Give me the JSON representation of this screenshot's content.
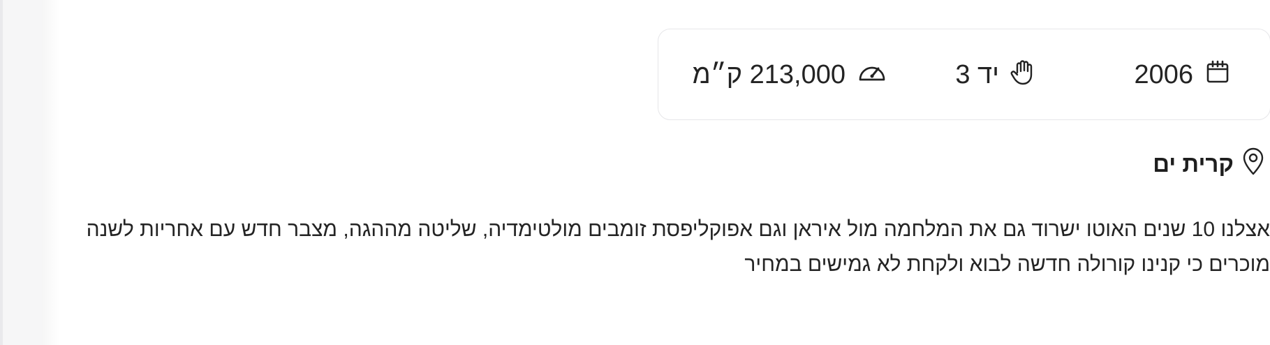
{
  "specs": {
    "year": {
      "icon": "calendar-icon",
      "value": "2006"
    },
    "hand": {
      "icon": "hand-icon",
      "value": "יד 3"
    },
    "mileage": {
      "icon": "speedometer-icon",
      "value": "213,000 ק״מ"
    }
  },
  "location": {
    "icon": "location-pin-icon",
    "label": "קרית ים"
  },
  "description": {
    "text": "אצלנו 10 שנים האוטו ישרוד גם את המלחמה מול איראן וגם אפוקליפסת זומבים מולטימדיה, שליטה מההגה, מצבר חדש עם אחריות לשנה מוכרים כי קנינו קורולה חדשה לבוא ולקחת לא גמישים במחיר"
  }
}
